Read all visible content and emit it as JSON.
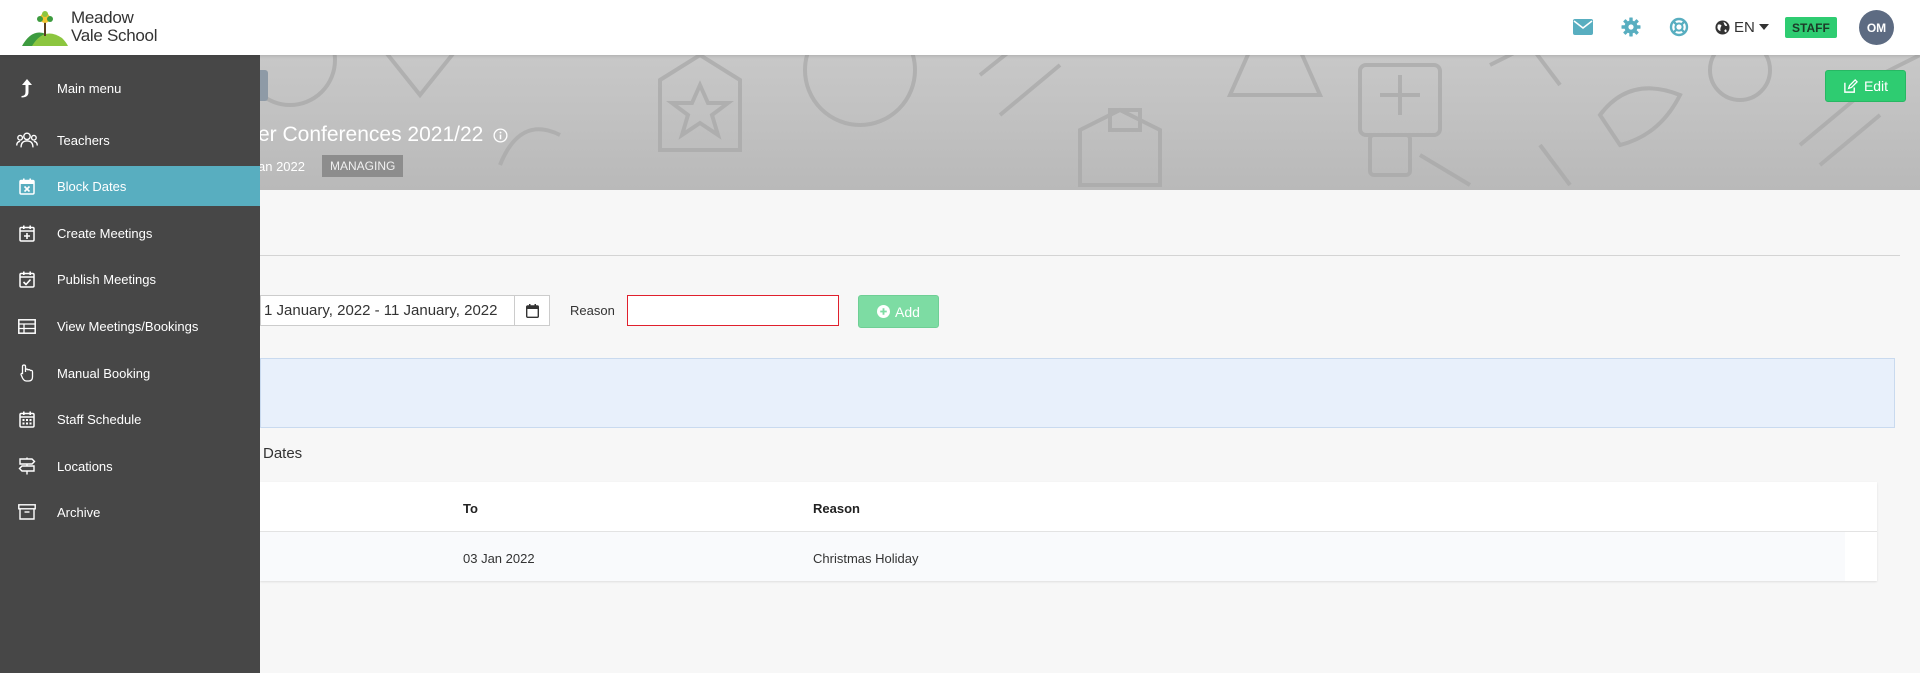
{
  "brand": {
    "name_line1": "Meadow",
    "name_line2": "Vale School"
  },
  "topbar": {
    "language": "EN",
    "role_badge": "STAFF",
    "avatar_initials": "OM"
  },
  "banner": {
    "title": "er Conferences 2021/22",
    "date": "an 2022",
    "status": "MANAGING",
    "edit_label": "Edit"
  },
  "sidebar": {
    "items": [
      {
        "label": "Main menu",
        "icon": "arrow-up-icon"
      },
      {
        "label": "Teachers",
        "icon": "users-icon"
      },
      {
        "label": "Block Dates",
        "icon": "calendar-x-icon",
        "active": true
      },
      {
        "label": "Create Meetings",
        "icon": "calendar-plus-icon"
      },
      {
        "label": "Publish Meetings",
        "icon": "calendar-check-icon"
      },
      {
        "label": "View Meetings/Bookings",
        "icon": "table-icon"
      },
      {
        "label": "Manual Booking",
        "icon": "hand-pointer-icon"
      },
      {
        "label": "Staff Schedule",
        "icon": "calendar-grid-icon"
      },
      {
        "label": "Locations",
        "icon": "signpost-icon"
      },
      {
        "label": "Archive",
        "icon": "archive-icon"
      }
    ]
  },
  "form": {
    "date_range_value": "1 January, 2022 - 11 January, 2022",
    "reason_label": "Reason",
    "reason_value": "",
    "add_label": "Add"
  },
  "section": {
    "title": "Dates"
  },
  "table": {
    "headers": [
      "To",
      "Reason"
    ],
    "rows": [
      {
        "to": "03 Jan 2022",
        "reason": "Christmas Holiday"
      }
    ]
  },
  "colors": {
    "accent": "#58aec0",
    "success": "#2ecc71",
    "sidebar_bg": "#474747",
    "error_border": "#e0202d"
  }
}
